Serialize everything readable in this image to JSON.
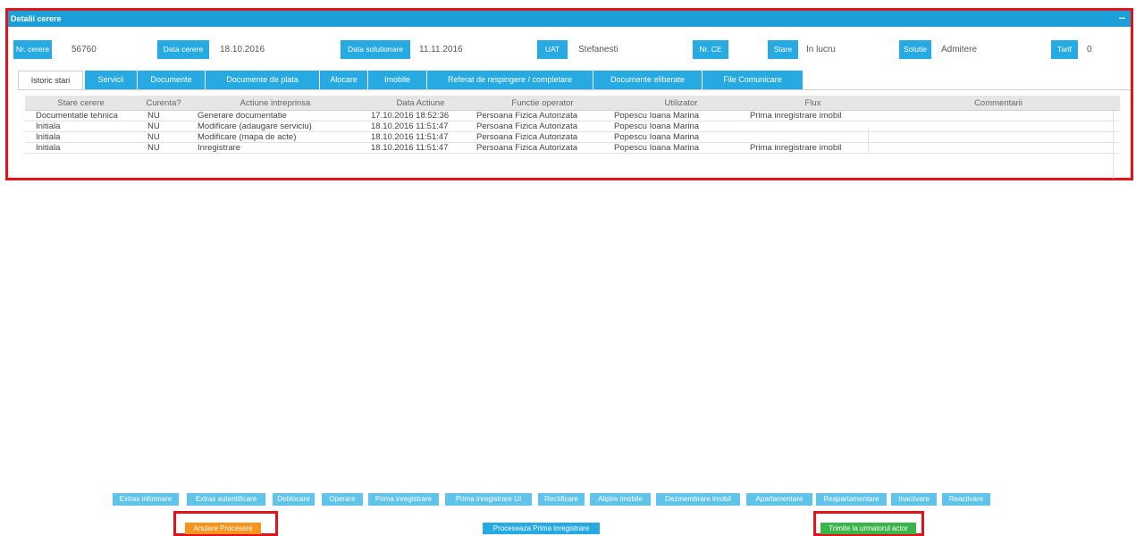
{
  "panel": {
    "title": "Detalii cerere",
    "collapse_symbol": "–"
  },
  "fields": {
    "nr_cerere": {
      "label": "Nr. cerere",
      "value": "56760"
    },
    "data_cerere": {
      "label": "Data cerere",
      "value": "18.10.2016"
    },
    "data_solutionare": {
      "label": "Data solutionare",
      "value": "11.11.2016"
    },
    "uat": {
      "label": "UAT",
      "value": "Stefanesti"
    },
    "nr_ce": {
      "label": "Nr. CE",
      "value": ""
    },
    "stare": {
      "label": "Stare",
      "value": "In lucru"
    },
    "solutie": {
      "label": "Solutie",
      "value": "Admitere"
    },
    "tarif": {
      "label": "Tarif",
      "value": "0"
    }
  },
  "tabs": [
    "Istoric stari",
    "Servicii",
    "Documente",
    "Documente de plata",
    "Alocare",
    "Imobile",
    "Referat de respingere / completare",
    "Documente eliberate",
    "File Comunicare"
  ],
  "table": {
    "columns": [
      "Stare cerere",
      "Curenta?",
      "Actiune intreprinsa",
      "Data Actiune",
      "Functie operator",
      "Utilizator",
      "Flux",
      "Commentarii"
    ],
    "rows": [
      [
        "Documentatie tehnica",
        "NU",
        "Generare documentatie",
        "17.10.2016 18:52:36",
        "Persoana Fizica Autorizata",
        "Popescu Ioana Marina",
        "Prima inregistrare imobil",
        ""
      ],
      [
        "Initiala",
        "NU",
        "Modificare (adaugare serviciu)",
        "18.10.2016 11:51:47",
        "Persoana Fizica Autorizata",
        "Popescu Ioana Marina",
        "",
        ""
      ],
      [
        "Initiala",
        "NU",
        "Modificare (mapa de acte)",
        "18.10.2016 11:51:47",
        "Persoana Fizica Autorizata",
        "Popescu Ioana Marina",
        "",
        ""
      ],
      [
        "Initiala",
        "NU",
        "Inregistrare",
        "18.10.2016 11:51:47",
        "Persoana Fizica Autorizata",
        "Popescu Ioana Marina",
        "Prima inregistrare imobil",
        ""
      ]
    ]
  },
  "actions": [
    "Extras informare",
    "Extras autentificare",
    "Deblocare",
    "Operare",
    "Prima inregistrare",
    "Prima inregistrare UI",
    "Rectificare",
    "Alipire imobile",
    "Dezmembrare imobil",
    "Apartamentare",
    "Reapartamentare",
    "Inactivare",
    "Reactivare"
  ],
  "bottom": {
    "cancel": "Anulare Procesare",
    "process": "Proceseaza Prima inregistrare",
    "send": "Trimite la urmatorul actor"
  }
}
